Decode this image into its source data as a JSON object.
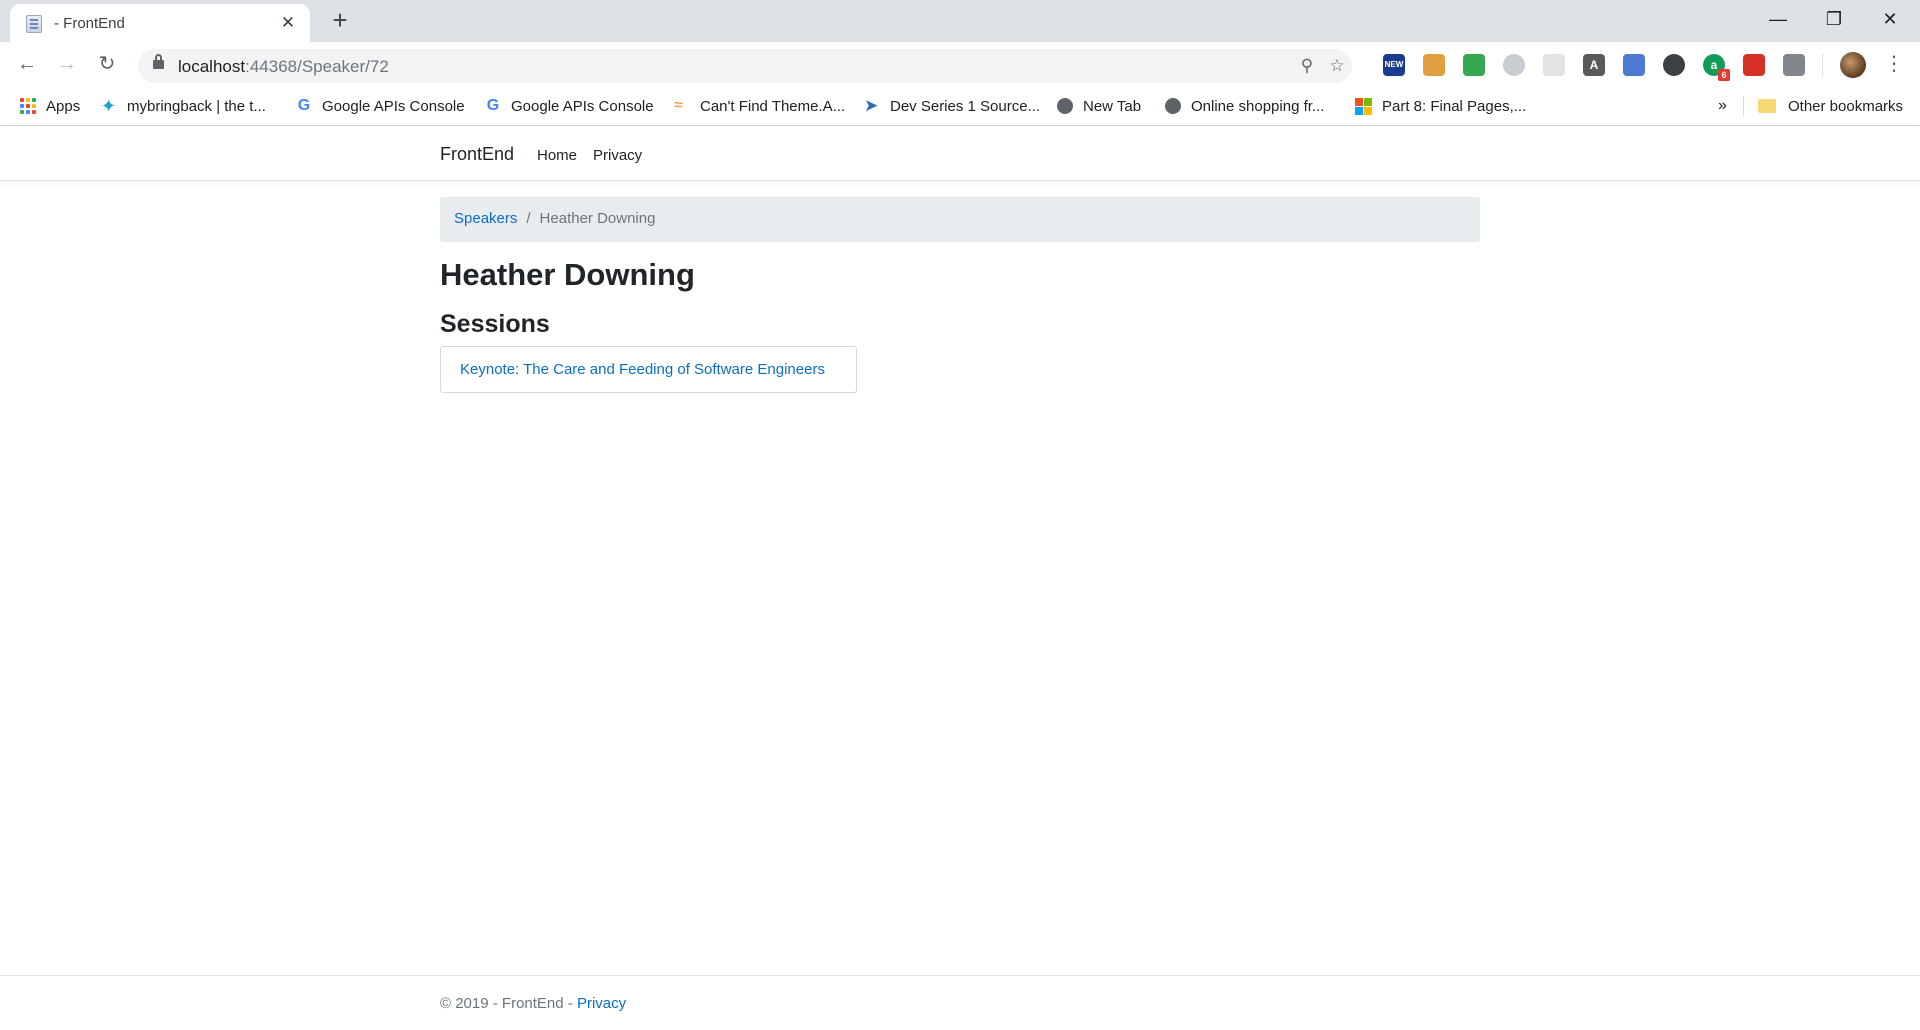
{
  "browser": {
    "tab_title": "- FrontEnd",
    "url_host": "localhost",
    "url_path": ":44368/Speaker/72",
    "bookmarks": [
      {
        "label": "Apps"
      },
      {
        "label": "mybringback | the t..."
      },
      {
        "label": "Google APIs Console"
      },
      {
        "label": "Google APIs Console"
      },
      {
        "label": "Can't Find Theme.A..."
      },
      {
        "label": "Dev Series 1 Source..."
      },
      {
        "label": "New Tab"
      },
      {
        "label": "Online shopping fr..."
      },
      {
        "label": "Part 8: Final Pages,..."
      }
    ],
    "overflow_label": "»",
    "other_bookmarks": "Other bookmarks",
    "extensions": [
      {
        "icon": "news-extension-icon",
        "label": "NEW",
        "color": "#1a3c8f"
      },
      {
        "icon": "cookie-extension-icon",
        "label": "",
        "color": "#e0a040"
      },
      {
        "icon": "shield-extension-icon",
        "label": "",
        "color": "#34a853"
      },
      {
        "icon": "circle-extension-icon",
        "label": "",
        "color": "#c9ccd1"
      },
      {
        "icon": "blank-extension-icon",
        "label": "",
        "color": "#e3e3e3"
      },
      {
        "icon": "font-extension-icon",
        "label": "A",
        "color": "#5a5a5a"
      },
      {
        "icon": "spiral-extension-icon",
        "label": "",
        "color": "#4a7bd0"
      },
      {
        "icon": "dark-circle-extension-icon",
        "label": "",
        "color": "#3c4043"
      },
      {
        "icon": "a-extension-icon",
        "label": "a",
        "color": "#0f9d58",
        "badge": "6"
      },
      {
        "icon": "pdf-extension-icon",
        "label": "",
        "color": "#d93025"
      },
      {
        "icon": "camera-extension-icon",
        "label": "",
        "color": "#80868b"
      }
    ]
  },
  "site": {
    "brand": "FrontEnd",
    "nav": [
      {
        "label": "Home"
      },
      {
        "label": "Privacy"
      }
    ]
  },
  "breadcrumb": {
    "parent": "Speakers",
    "separator": "/",
    "current": "Heather Downing"
  },
  "speaker": {
    "name": "Heather Downing",
    "sessions_heading": "Sessions",
    "sessions": [
      {
        "title": "Keynote: The Care and Feeding of Software Engineers"
      }
    ]
  },
  "footer": {
    "text": "© 2019 - FrontEnd - ",
    "link": "Privacy"
  },
  "colors": {
    "link": "#0b6ec5",
    "breadcrumb_bg": "#e9ecef",
    "text": "#212529",
    "muted": "#6c757d"
  }
}
